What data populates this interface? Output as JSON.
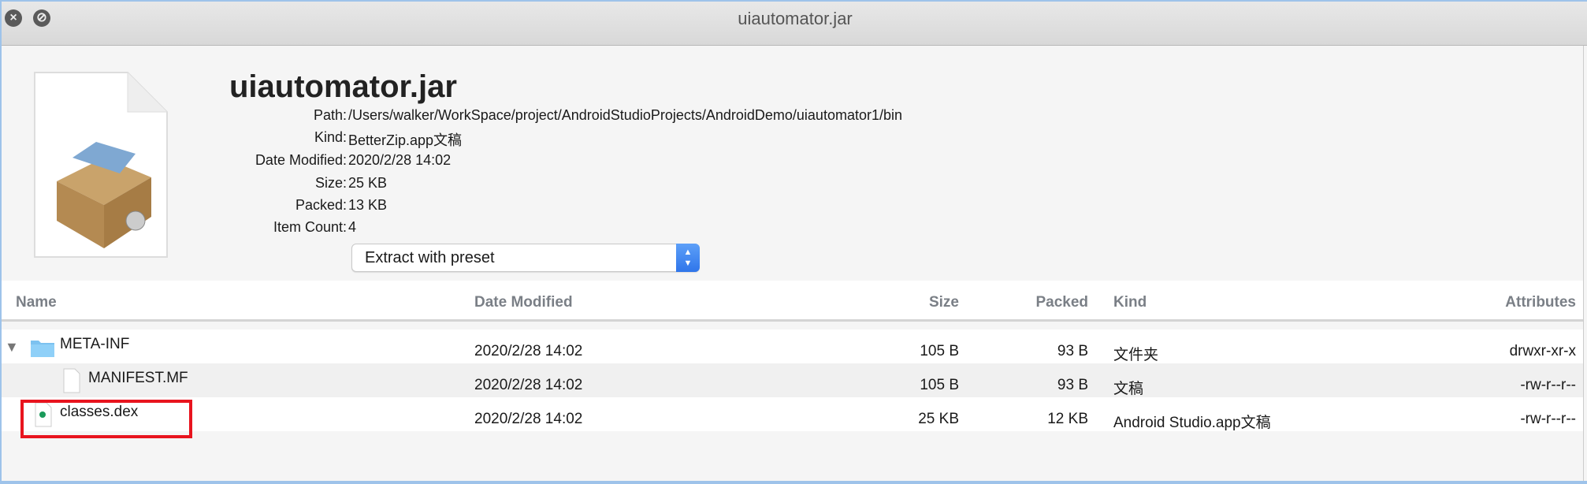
{
  "window": {
    "title": "uiautomator.jar",
    "close_icon": "close-icon",
    "minimize_icon": "disabled-icon"
  },
  "info": {
    "name": "uiautomator.jar",
    "fields": [
      {
        "label": "Path:",
        "value": "/Users/walker/WorkSpace/project/AndroidStudioProjects/AndroidDemo/uiautomator1/bin"
      },
      {
        "label": "Kind:",
        "value": "BetterZip.app文稿"
      },
      {
        "label": "Date Modified:",
        "value": "2020/2/28 14:02"
      },
      {
        "label": "Size:",
        "value": "25 KB"
      },
      {
        "label": "Packed:",
        "value": "13 KB"
      },
      {
        "label": "Item Count:",
        "value": "4"
      }
    ],
    "extract_select": "Extract with preset"
  },
  "table": {
    "headers": {
      "name": "Name",
      "date": "Date Modified",
      "size": "Size",
      "packed": "Packed",
      "kind": "Kind",
      "attributes": "Attributes"
    },
    "rows": [
      {
        "name": "META-INF",
        "date": "2020/2/28 14:02",
        "size": "105 B",
        "packed": "93 B",
        "kind": "文件夹",
        "attributes": "drwxr-xr-x",
        "icon": "folder-icon",
        "expanded": true
      },
      {
        "name": "MANIFEST.MF",
        "date": "2020/2/28 14:02",
        "size": "105 B",
        "packed": "93 B",
        "kind": "文稿",
        "attributes": "-rw-r--r--",
        "icon": "document-icon"
      },
      {
        "name": "classes.dex",
        "date": "2020/2/28 14:02",
        "size": "25 KB",
        "packed": "12 KB",
        "kind": "Android Studio.app文稿",
        "attributes": "-rw-r--r--",
        "icon": "dex-file-icon",
        "highlighted": true
      }
    ]
  },
  "colors": {
    "highlight": "#e8141e",
    "accent": "#2f75ea"
  }
}
